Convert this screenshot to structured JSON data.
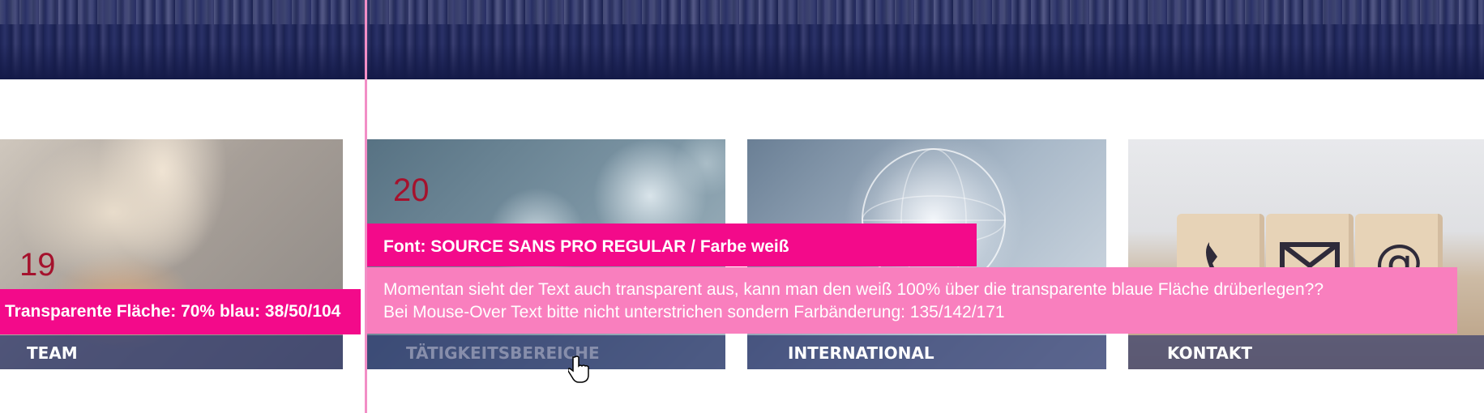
{
  "tiles": {
    "team": {
      "label": "TEAM"
    },
    "taetigkeit": {
      "label": "TÄTIGKEITSBEREICHE"
    },
    "international": {
      "label": "INTERNATIONAL"
    },
    "kontakt": {
      "label": "KONTAKT"
    }
  },
  "annotations": {
    "number_19": "19",
    "number_20": "20",
    "team_note": "Transparente Fläche: 70% blau: 38/50/104",
    "font_note": "Font:  SOURCE SANS PRO REGULAR / Farbe weiß",
    "text_note_line1": "Momentan sieht der Text auch transparent aus, kann man den weiß 100% über die transparente blaue Fläche drüberlegen??",
    "text_note_line2": "Bei Mouse-Over Text bitte nicht unterstrichen sondern Farbänderung: 135/142/171"
  },
  "colors": {
    "overlay_blue": "#263268",
    "hover_text": "#878eab",
    "annotation_pink": "#f30a8a",
    "annotation_light_pink": "#f97fbe",
    "number_red": "#a5122d"
  },
  "icons": {
    "cursor": "hand-pointer-icon",
    "kontakt_blocks": [
      "phone-icon",
      "envelope-icon",
      "at-sign-icon"
    ]
  }
}
